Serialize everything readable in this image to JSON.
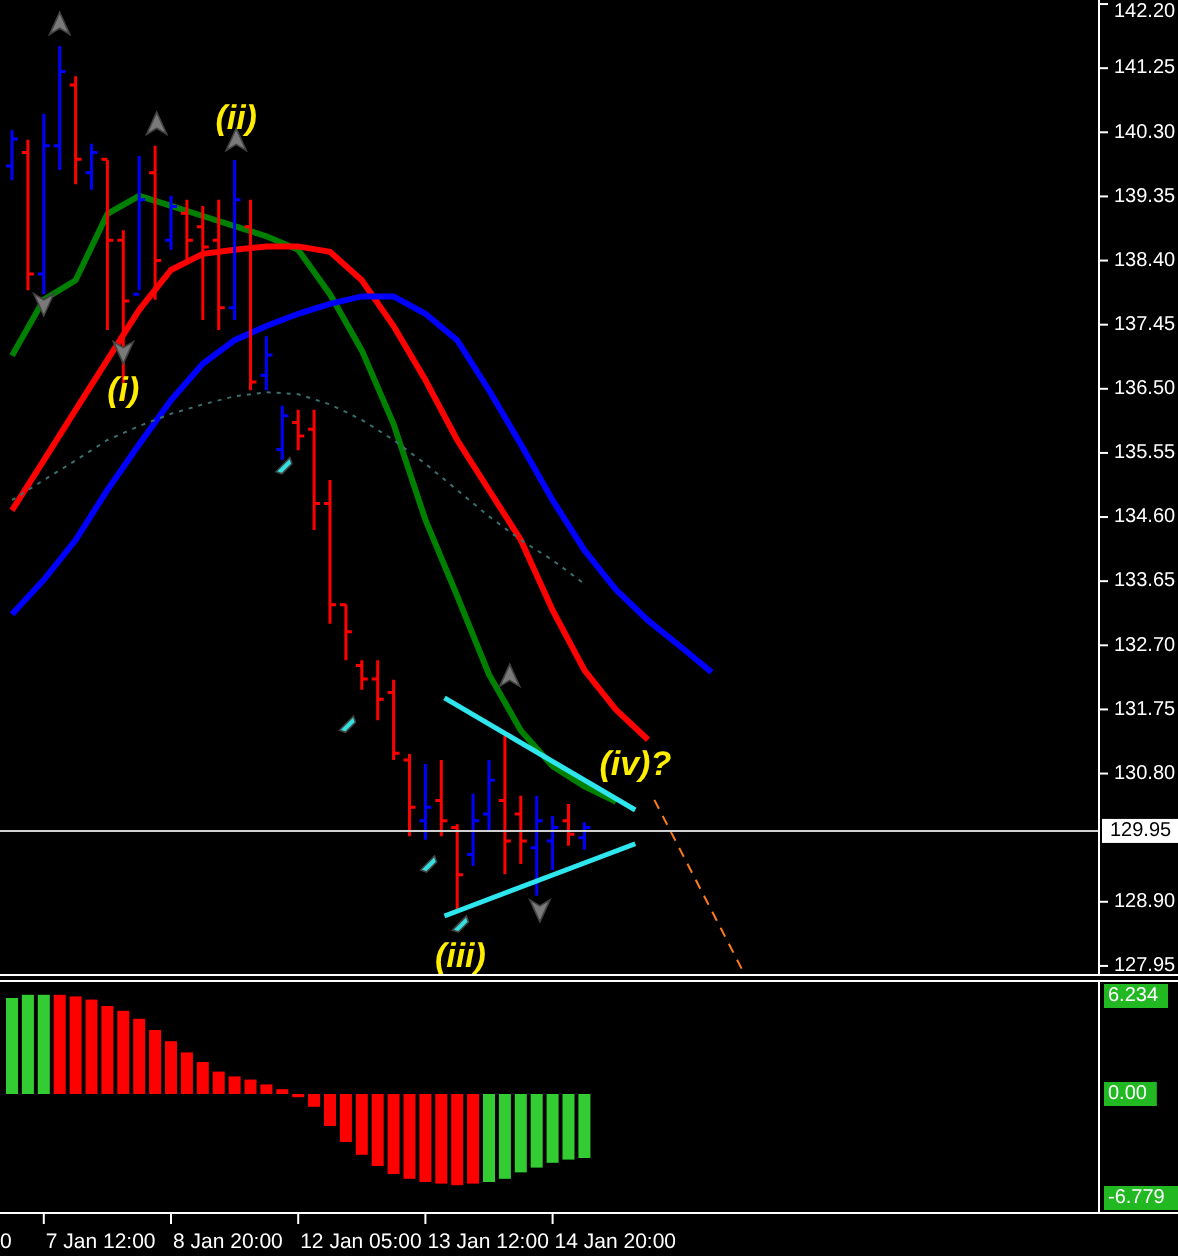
{
  "price_axis": [
    "142.20",
    "141.25",
    "140.30",
    "139.35",
    "138.40",
    "137.45",
    "136.50",
    "135.55",
    "134.60",
    "133.65",
    "132.70",
    "131.75",
    "130.80",
    "128.90",
    "127.95"
  ],
  "current_price": "129.95",
  "wave_labels": [
    "(ii)",
    "(i)",
    "(iii)",
    "(iv)?"
  ],
  "oscillator_axis": [
    "6.234",
    "0.00",
    "-6.779"
  ],
  "time_axis": [
    "0",
    "7 Jan 12:00",
    "8 Jan 20:00",
    "12 Jan 05:00",
    "13 Jan 12:00",
    "14 Jan 20:00"
  ]
}
